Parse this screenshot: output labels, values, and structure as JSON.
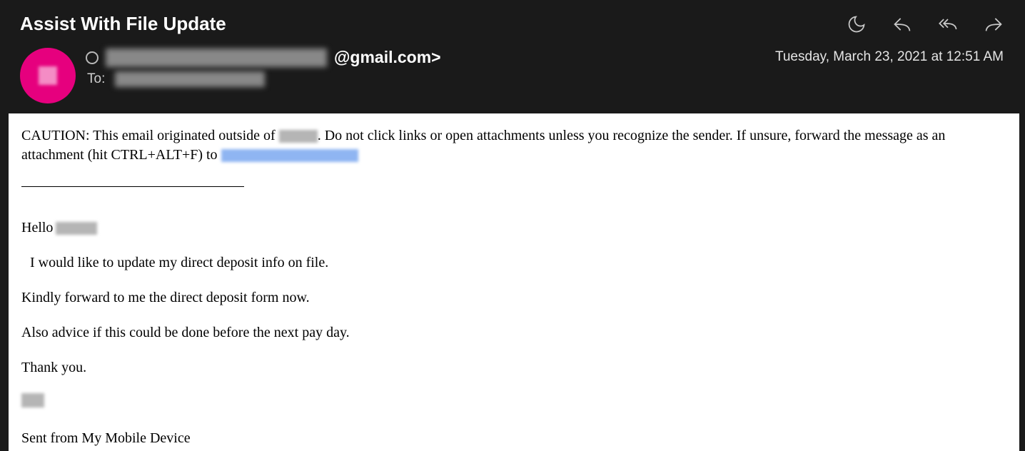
{
  "subject": "Assist With File Update",
  "from_visible_suffix": "@gmail.com>",
  "to_label": "To:",
  "timestamp": "Tuesday, March 23, 2021 at 12:51 AM",
  "caution": {
    "part1": "CAUTION: This email originated outside of ",
    "part2": ". Do not click links or open attachments unless you recognize the sender. If unsure, forward the message as an attachment (hit CTRL+ALT+F) to "
  },
  "body": {
    "hello": "Hello ",
    "line1": " I would like to update my direct deposit info on file.",
    "line2": "Kindly forward to me the direct deposit form now.",
    "line3": "Also advice if this could be done before the next pay day.",
    "line4": "Thank you.",
    "signature": "Sent from My Mobile Device"
  },
  "icons": {
    "dark_mode": "dark-mode-icon",
    "reply": "reply-icon",
    "reply_all": "reply-all-icon",
    "forward": "forward-icon"
  }
}
